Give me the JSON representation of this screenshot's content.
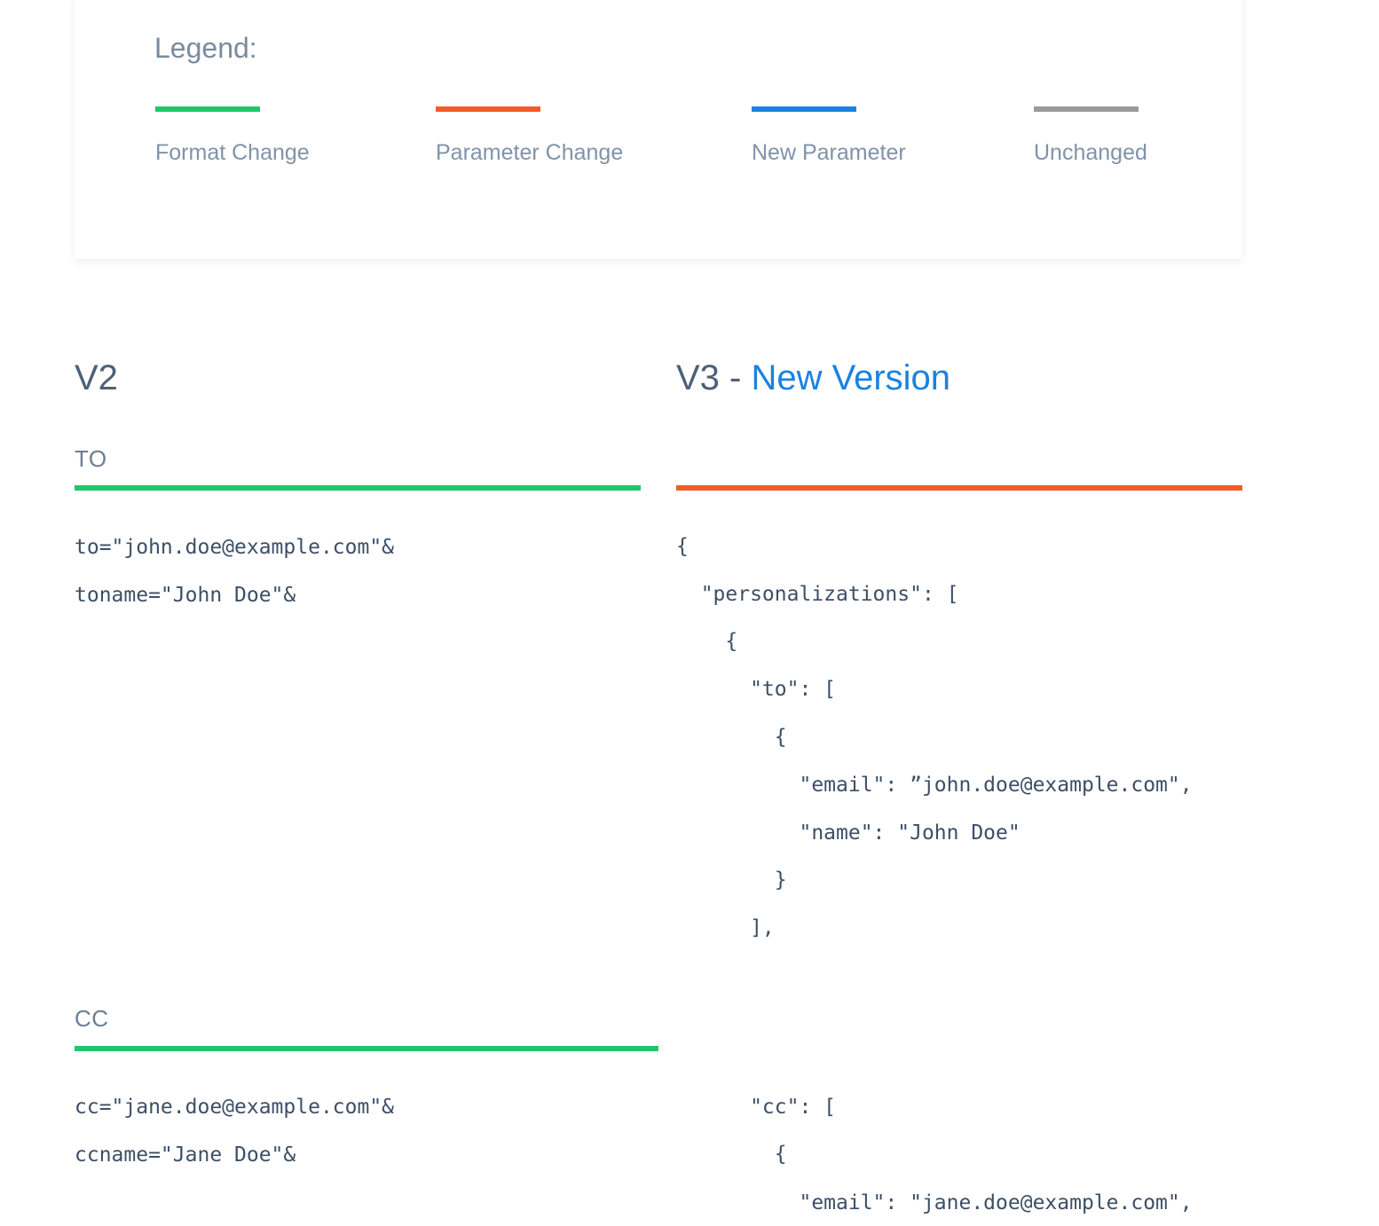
{
  "legend": {
    "title": "Legend:",
    "items": [
      {
        "label": "Format Change",
        "color": "#22c66a"
      },
      {
        "label": "Parameter Change",
        "color": "#f25c26"
      },
      {
        "label": "New Parameter",
        "color": "#1a82e2"
      },
      {
        "label": "Unchanged",
        "color": "#9a9a9a"
      }
    ]
  },
  "v2": {
    "heading": "V2",
    "sections": [
      {
        "label": "TO",
        "lines": [
          "to=\"john.doe@example.com\"&",
          "toname=\"John Doe\"&"
        ]
      },
      {
        "label": "CC",
        "lines": [
          "cc=\"jane.doe@example.com\"&",
          "ccname=\"Jane Doe\"&"
        ]
      }
    ]
  },
  "v3": {
    "heading_prefix": "V3 - ",
    "heading_accent": "New Version",
    "to_lines": [
      "{",
      "  \"personalizations\": [",
      "    {",
      "      \"to\": [",
      "        {",
      "          \"email\": ”john.doe@example.com\",",
      "          \"name\": \"John Doe\"",
      "        }",
      "      ],"
    ],
    "cc_lines": [
      "      \"cc\": [",
      "        {",
      "          \"email\": \"jane.doe@example.com\","
    ]
  }
}
